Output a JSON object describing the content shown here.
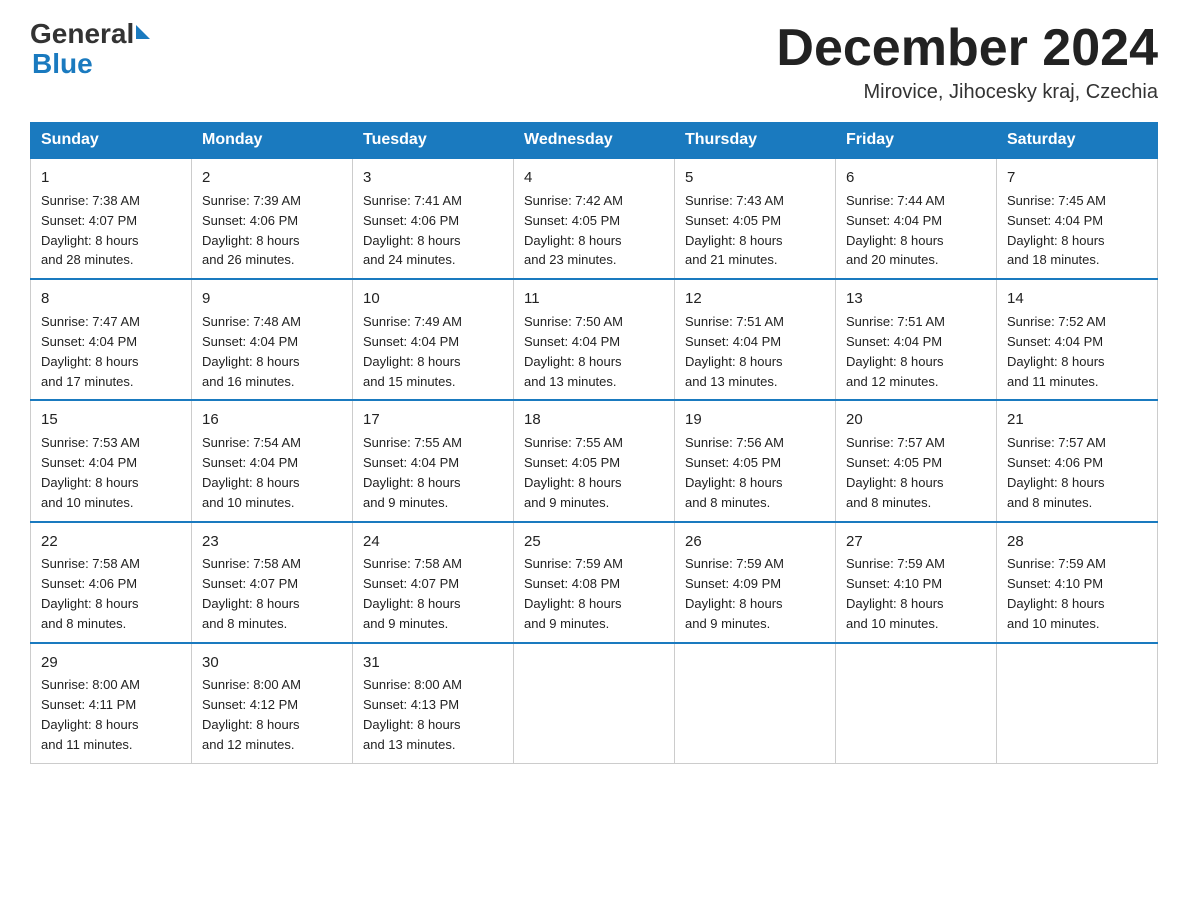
{
  "header": {
    "logo_general": "General",
    "logo_blue": "Blue",
    "month_title": "December 2024",
    "location": "Mirovice, Jihocesky kraj, Czechia"
  },
  "days_of_week": [
    "Sunday",
    "Monday",
    "Tuesday",
    "Wednesday",
    "Thursday",
    "Friday",
    "Saturday"
  ],
  "weeks": [
    [
      {
        "day": "1",
        "sunrise": "7:38 AM",
        "sunset": "4:07 PM",
        "daylight": "8 hours and 28 minutes."
      },
      {
        "day": "2",
        "sunrise": "7:39 AM",
        "sunset": "4:06 PM",
        "daylight": "8 hours and 26 minutes."
      },
      {
        "day": "3",
        "sunrise": "7:41 AM",
        "sunset": "4:06 PM",
        "daylight": "8 hours and 24 minutes."
      },
      {
        "day": "4",
        "sunrise": "7:42 AM",
        "sunset": "4:05 PM",
        "daylight": "8 hours and 23 minutes."
      },
      {
        "day": "5",
        "sunrise": "7:43 AM",
        "sunset": "4:05 PM",
        "daylight": "8 hours and 21 minutes."
      },
      {
        "day": "6",
        "sunrise": "7:44 AM",
        "sunset": "4:04 PM",
        "daylight": "8 hours and 20 minutes."
      },
      {
        "day": "7",
        "sunrise": "7:45 AM",
        "sunset": "4:04 PM",
        "daylight": "8 hours and 18 minutes."
      }
    ],
    [
      {
        "day": "8",
        "sunrise": "7:47 AM",
        "sunset": "4:04 PM",
        "daylight": "8 hours and 17 minutes."
      },
      {
        "day": "9",
        "sunrise": "7:48 AM",
        "sunset": "4:04 PM",
        "daylight": "8 hours and 16 minutes."
      },
      {
        "day": "10",
        "sunrise": "7:49 AM",
        "sunset": "4:04 PM",
        "daylight": "8 hours and 15 minutes."
      },
      {
        "day": "11",
        "sunrise": "7:50 AM",
        "sunset": "4:04 PM",
        "daylight": "8 hours and 13 minutes."
      },
      {
        "day": "12",
        "sunrise": "7:51 AM",
        "sunset": "4:04 PM",
        "daylight": "8 hours and 13 minutes."
      },
      {
        "day": "13",
        "sunrise": "7:51 AM",
        "sunset": "4:04 PM",
        "daylight": "8 hours and 12 minutes."
      },
      {
        "day": "14",
        "sunrise": "7:52 AM",
        "sunset": "4:04 PM",
        "daylight": "8 hours and 11 minutes."
      }
    ],
    [
      {
        "day": "15",
        "sunrise": "7:53 AM",
        "sunset": "4:04 PM",
        "daylight": "8 hours and 10 minutes."
      },
      {
        "day": "16",
        "sunrise": "7:54 AM",
        "sunset": "4:04 PM",
        "daylight": "8 hours and 10 minutes."
      },
      {
        "day": "17",
        "sunrise": "7:55 AM",
        "sunset": "4:04 PM",
        "daylight": "8 hours and 9 minutes."
      },
      {
        "day": "18",
        "sunrise": "7:55 AM",
        "sunset": "4:05 PM",
        "daylight": "8 hours and 9 minutes."
      },
      {
        "day": "19",
        "sunrise": "7:56 AM",
        "sunset": "4:05 PM",
        "daylight": "8 hours and 8 minutes."
      },
      {
        "day": "20",
        "sunrise": "7:57 AM",
        "sunset": "4:05 PM",
        "daylight": "8 hours and 8 minutes."
      },
      {
        "day": "21",
        "sunrise": "7:57 AM",
        "sunset": "4:06 PM",
        "daylight": "8 hours and 8 minutes."
      }
    ],
    [
      {
        "day": "22",
        "sunrise": "7:58 AM",
        "sunset": "4:06 PM",
        "daylight": "8 hours and 8 minutes."
      },
      {
        "day": "23",
        "sunrise": "7:58 AM",
        "sunset": "4:07 PM",
        "daylight": "8 hours and 8 minutes."
      },
      {
        "day": "24",
        "sunrise": "7:58 AM",
        "sunset": "4:07 PM",
        "daylight": "8 hours and 9 minutes."
      },
      {
        "day": "25",
        "sunrise": "7:59 AM",
        "sunset": "4:08 PM",
        "daylight": "8 hours and 9 minutes."
      },
      {
        "day": "26",
        "sunrise": "7:59 AM",
        "sunset": "4:09 PM",
        "daylight": "8 hours and 9 minutes."
      },
      {
        "day": "27",
        "sunrise": "7:59 AM",
        "sunset": "4:10 PM",
        "daylight": "8 hours and 10 minutes."
      },
      {
        "day": "28",
        "sunrise": "7:59 AM",
        "sunset": "4:10 PM",
        "daylight": "8 hours and 10 minutes."
      }
    ],
    [
      {
        "day": "29",
        "sunrise": "8:00 AM",
        "sunset": "4:11 PM",
        "daylight": "8 hours and 11 minutes."
      },
      {
        "day": "30",
        "sunrise": "8:00 AM",
        "sunset": "4:12 PM",
        "daylight": "8 hours and 12 minutes."
      },
      {
        "day": "31",
        "sunrise": "8:00 AM",
        "sunset": "4:13 PM",
        "daylight": "8 hours and 13 minutes."
      },
      null,
      null,
      null,
      null
    ]
  ],
  "labels": {
    "sunrise": "Sunrise:",
    "sunset": "Sunset:",
    "daylight": "Daylight:"
  }
}
